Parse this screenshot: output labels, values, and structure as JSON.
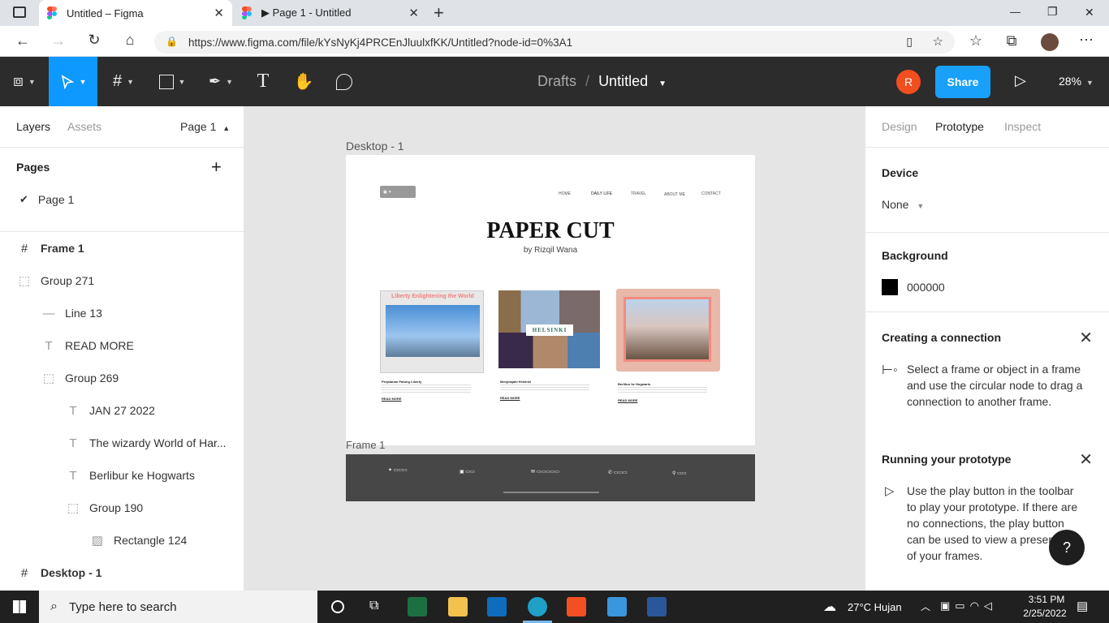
{
  "browser": {
    "tabs": [
      {
        "label": "Untitled – Figma",
        "active": true
      },
      {
        "label": "▶ Page 1 - Untitled",
        "active": false
      }
    ],
    "new_tab": "+",
    "url": "https://www.figma.com/file/kYsNyKj4PRCEnJluulxfKK/Untitled?node-id=0%3A1",
    "window": {
      "min": "—",
      "max": "❐",
      "close": "✕"
    }
  },
  "figma": {
    "breadcrumb": {
      "drafts": "Drafts",
      "sep": "/",
      "file": "Untitled"
    },
    "avatar_letter": "R",
    "share_label": "Share",
    "zoom": "28%"
  },
  "left_panel": {
    "tabs": {
      "layers": "Layers",
      "assets": "Assets",
      "page": "Page 1"
    },
    "pages_title": "Pages",
    "add_page": "+",
    "pages": [
      "Page 1"
    ],
    "layers": [
      {
        "label": "Frame 1",
        "indent": 0,
        "icon": "#",
        "bold": true
      },
      {
        "label": "Group 271",
        "indent": 0,
        "icon": "⬚",
        "bold": false
      },
      {
        "label": "Line 13",
        "indent": 1,
        "icon": "—",
        "bold": false
      },
      {
        "label": "READ MORE",
        "indent": 1,
        "icon": "T",
        "bold": false
      },
      {
        "label": "Group 269",
        "indent": 1,
        "icon": "⬚",
        "bold": false
      },
      {
        "label": "JAN 27 2022",
        "indent": 2,
        "icon": "T",
        "bold": false
      },
      {
        "label": "The wizardy World of Har...",
        "indent": 2,
        "icon": "T",
        "bold": false
      },
      {
        "label": "Berlibur ke Hogwarts",
        "indent": 2,
        "icon": "T",
        "bold": false
      },
      {
        "label": "Group 190",
        "indent": 2,
        "icon": "⬚",
        "bold": false
      },
      {
        "label": "Rectangle 124",
        "indent": 3,
        "icon": "▨",
        "bold": false
      },
      {
        "label": "Desktop - 1",
        "indent": 0,
        "icon": "#",
        "bold": true
      }
    ]
  },
  "canvas": {
    "frame_label_desktop": "Desktop - 1",
    "frame_label_frame1": "Frame 1",
    "site": {
      "nav": [
        "HOME",
        "DAILY LIFE",
        "TRAVEL",
        "ABOUT ME",
        "CONTACT"
      ],
      "title": "PAPER CUT",
      "subtitle": "by Rizqil Wana",
      "cards": [
        {
          "banner": "Liberty Enlightening the World",
          "title": "Perjalanan Patung Liberty",
          "more": "READ MORE"
        },
        {
          "banner": "HELSINKI",
          "title": "Menjelajahi Helsinki",
          "more": "READ MORE"
        },
        {
          "banner": "",
          "title": "Berlibur ke Hogwarts",
          "more": "READ MORE"
        }
      ]
    }
  },
  "right_panel": {
    "tabs": {
      "design": "Design",
      "prototype": "Prototype",
      "inspect": "Inspect"
    },
    "device_title": "Device",
    "device_value": "None",
    "background_title": "Background",
    "background_value": "000000",
    "connection_title": "Creating a connection",
    "connection_text": "Select a frame or object in a frame and use the circular node to drag a connection to another frame.",
    "running_title": "Running your prototype",
    "running_text": "Use the play button in the toolbar to play your prototype. If there are no connections, the play button can be used to view a presentation of your frames.",
    "help": "?"
  },
  "taskbar": {
    "search_placeholder": "Type here to search",
    "weather": "27°C  Hujan",
    "time": "3:51 PM",
    "date": "2/25/2022"
  },
  "colors": {
    "accent": "#18a0fb",
    "avatar": "#f24e1e",
    "toolbar": "#2c2c2c",
    "active_tool": "#0d99ff"
  }
}
